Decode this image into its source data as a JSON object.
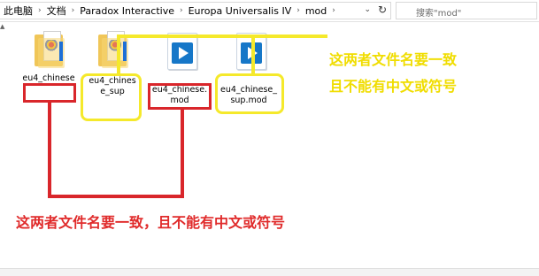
{
  "address": {
    "crumbs": [
      "此电脑",
      "文档",
      "Paradox Interactive",
      "Europa Universalis IV",
      "mod"
    ],
    "search_placeholder": "搜索\"mod\""
  },
  "files": [
    {
      "name": "eu4_chinese",
      "type": "folder"
    },
    {
      "name": "eu4_chinese_sup",
      "type": "folder"
    },
    {
      "name": "eu4_chinese.mod",
      "type": "mod"
    },
    {
      "name": "eu4_chinese_sup.mod",
      "type": "mod"
    }
  ],
  "annotations": {
    "yellow_line1": "这两者文件名要一致",
    "yellow_line2": "且不能有中文或符号",
    "red_text": "这两者文件名要一致，且不能有中文或符号"
  },
  "colors": {
    "annotation_red": "#d9262b",
    "annotation_yellow": "#f5e92b",
    "folder": "#f8d775",
    "mod_icon_blue": "#1677c8"
  }
}
